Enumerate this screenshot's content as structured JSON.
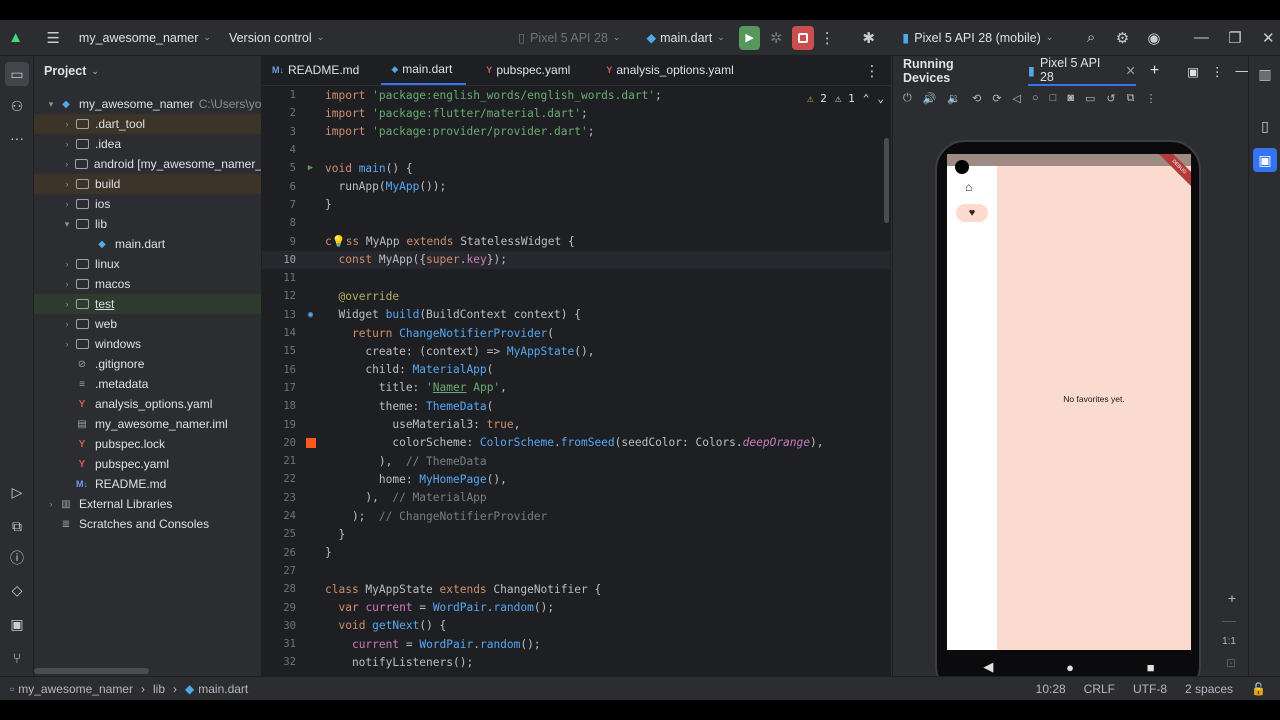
{
  "toolbar": {
    "project": "my_awesome_namer",
    "vcs": "Version control",
    "device_dim": "Pixel 5 API 28",
    "run_config": "main.dart",
    "device": "Pixel 5 API 28 (mobile)"
  },
  "project_panel": {
    "title": "Project",
    "root": "my_awesome_namer",
    "root_path": "C:\\Users\\yo",
    "items": [
      {
        "label": ".dart_tool"
      },
      {
        "label": ".idea"
      },
      {
        "label": "android [my_awesome_namer_"
      },
      {
        "label": "build"
      },
      {
        "label": "ios"
      },
      {
        "label": "lib"
      },
      {
        "label": "main.dart"
      },
      {
        "label": "linux"
      },
      {
        "label": "macos"
      },
      {
        "label": "test"
      },
      {
        "label": "web"
      },
      {
        "label": "windows"
      },
      {
        "label": ".gitignore"
      },
      {
        "label": ".metadata"
      },
      {
        "label": "analysis_options.yaml"
      },
      {
        "label": "my_awesome_namer.iml"
      },
      {
        "label": "pubspec.lock"
      },
      {
        "label": "pubspec.yaml"
      },
      {
        "label": "README.md"
      },
      {
        "label": "External Libraries"
      },
      {
        "label": "Scratches and Consoles"
      }
    ]
  },
  "editor": {
    "tabs": [
      {
        "icon": "M↓",
        "label": "README.md"
      },
      {
        "icon": "◆",
        "label": "main.dart"
      },
      {
        "icon": "Y",
        "label": "pubspec.yaml"
      },
      {
        "icon": "Y",
        "label": "analysis_options.yaml"
      }
    ],
    "warnings": "2",
    "weak_warnings": "1",
    "line_numbers": [
      "1",
      "2",
      "3",
      "4",
      "5",
      "6",
      "7",
      "8",
      "9",
      "10",
      "11",
      "12",
      "13",
      "14",
      "15",
      "16",
      "17",
      "18",
      "19",
      "20",
      "21",
      "22",
      "23",
      "24",
      "25",
      "26",
      "27",
      "28",
      "29",
      "30",
      "31",
      "32"
    ]
  },
  "devices": {
    "title": "Running Devices",
    "tab": "Pixel 5 API 28",
    "empty_message": "No favorites yet.",
    "debug_banner": "DEBUG",
    "zoom_label": "1:1"
  },
  "statusbar": {
    "crumb_project": "my_awesome_namer",
    "crumb_lib": "lib",
    "crumb_file": "main.dart",
    "position": "10:28",
    "line_sep": "CRLF",
    "encoding": "UTF-8",
    "indent": "2 spaces"
  },
  "colors": {
    "accent": "#3574f0",
    "run": "#57965c",
    "stop": "#c94f4f",
    "app_bg": "#fbdbd0"
  }
}
